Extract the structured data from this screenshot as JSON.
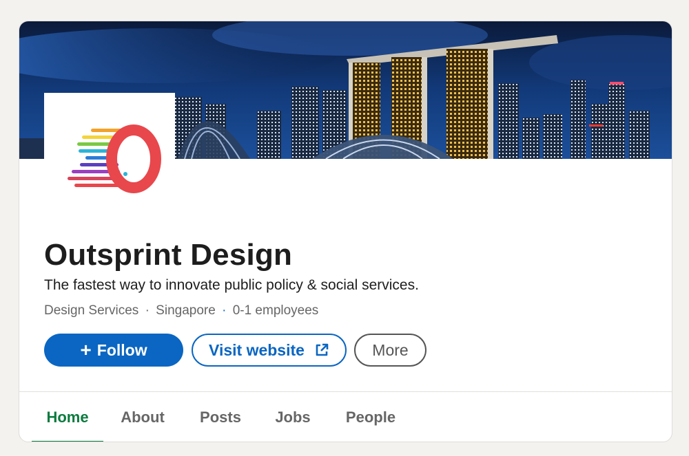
{
  "company": {
    "name": "Outsprint Design",
    "tagline": "The fastest way to innovate public policy & social services.",
    "industry": "Design Services",
    "location": "Singapore",
    "size": "0-1 employees"
  },
  "meta_separators": {
    "first": "·",
    "second": "·"
  },
  "actions": {
    "follow_label": "Follow",
    "follow_icon": "plus-icon",
    "visit_label": "Visit website",
    "visit_icon": "external-link-icon",
    "more_label": "More"
  },
  "tabs": [
    {
      "label": "Home",
      "active": true
    },
    {
      "label": "About",
      "active": false
    },
    {
      "label": "Posts",
      "active": false
    },
    {
      "label": "Jobs",
      "active": false
    },
    {
      "label": "People",
      "active": false
    }
  ],
  "colors": {
    "primary": "#0a66c2",
    "active_tab": "#0b7a3e",
    "logo_ring": "#e8474c",
    "page_bg": "#f3f2ef"
  }
}
